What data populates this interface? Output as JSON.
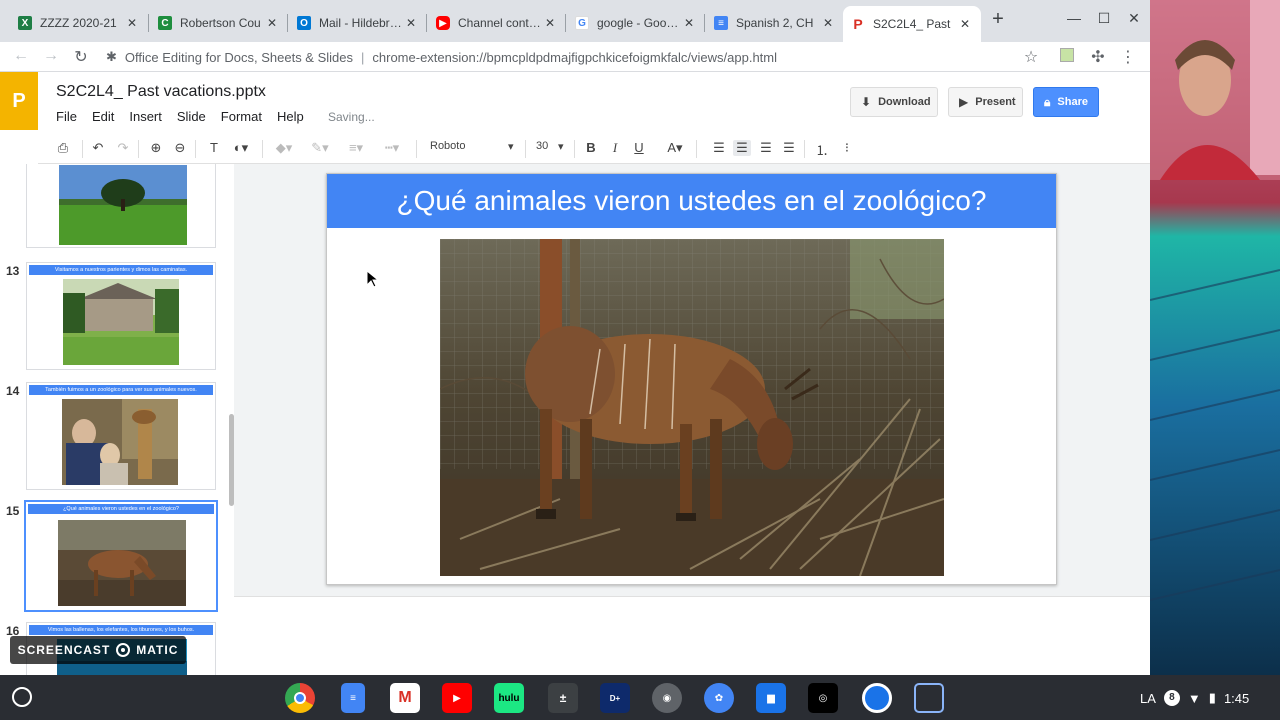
{
  "browser": {
    "tabs": [
      {
        "label": "ZZZZ 2020-21",
        "favicon": "excel-icon",
        "color": "#1e7e45"
      },
      {
        "label": "Robertson Cou",
        "favicon": "classroom-icon",
        "color": "#1e8e3e"
      },
      {
        "label": "Mail - Hildebran",
        "favicon": "outlook-icon",
        "color": "#0078d4"
      },
      {
        "label": "Channel conten",
        "favicon": "youtube-icon",
        "color": "#ff0000"
      },
      {
        "label": "google - Google",
        "favicon": "google-icon",
        "color": "#4285f4"
      },
      {
        "label": "Spanish 2, CH",
        "favicon": "docs-icon",
        "color": "#4285f4"
      },
      {
        "label": "S2C2L4_ Past",
        "favicon": "slides-icon",
        "color": "#d93025",
        "active": true
      }
    ],
    "omnibox": {
      "extension_name": "Office Editing for Docs, Sheets & Slides",
      "url": "chrome-extension://bpmcpldpdmajfigpchkicefoigmkfalc/views/app.html"
    }
  },
  "app": {
    "logo_letter": "P",
    "doc_title": "S2C2L4_ Past vacations.pptx",
    "menu": [
      "File",
      "Edit",
      "Insert",
      "Slide",
      "Format",
      "Help"
    ],
    "status": "Saving...",
    "buttons": {
      "download": "Download",
      "present": "Present",
      "share": "Share"
    },
    "toolbar": {
      "font": "Roboto",
      "font_size": "30"
    }
  },
  "filmstrip": {
    "slides": [
      {
        "number": "",
        "title": ""
      },
      {
        "number": "13",
        "title": "Visitamos a nuestros parientes y dimos las caminatas."
      },
      {
        "number": "14",
        "title": "También fuimos a un zoológico para ver sus animales nuevos."
      },
      {
        "number": "15",
        "title": "¿Qué animales vieron ustedes en el zoológico?",
        "selected": true
      },
      {
        "number": "16",
        "title": "Vimos las ballenas, los elefantes, los tiburones, y los buhos."
      }
    ]
  },
  "slide": {
    "title": "¿Qué animales vieron ustedes en el zoológico?",
    "title_bg": "#4285f4"
  },
  "watermark": {
    "left": "SCREENCAST",
    "right": "MATIC"
  },
  "shelf": {
    "apps": [
      "chrome-icon",
      "docs-icon",
      "gmail-icon",
      "youtube-icon",
      "hulu-icon",
      "calculator-icon",
      "disney-plus-icon",
      "camera-icon",
      "palette-icon",
      "files-icon",
      "screencastify-icon",
      "screencast-o-matic-icon",
      "screen-capture-icon"
    ],
    "hulu_label": "hulu",
    "status": {
      "ime": "LA",
      "notification_count": "8",
      "time": "1:45"
    }
  }
}
